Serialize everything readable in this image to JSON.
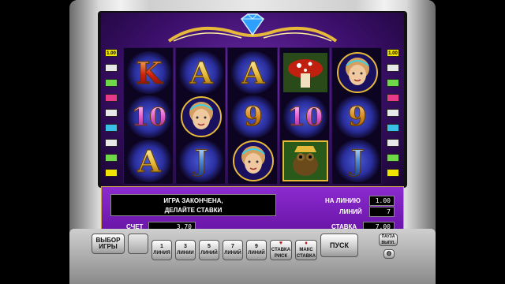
{
  "reels": [
    [
      "K",
      "10",
      "A"
    ],
    [
      "A",
      "woman-pic",
      "J"
    ],
    [
      "A",
      "9",
      "woman-face"
    ],
    [
      "mushroom",
      "10",
      "frog"
    ],
    [
      "woman-face",
      "9",
      "J"
    ]
  ],
  "line_indicators": {
    "left": [
      "1.00",
      "",
      "",
      "",
      "",
      "",
      "",
      "",
      ""
    ],
    "right": [
      "1.00",
      "",
      "",
      "",
      "",
      "",
      "",
      "",
      ""
    ]
  },
  "message": {
    "line1": "ИГРА ЗАКОНЧЕНА,",
    "line2": "ДЕЛАЙТЕ СТАВКИ"
  },
  "stats": {
    "per_line_label": "НА ЛИНИЮ",
    "per_line_value": "1.00",
    "lines_label": "ЛИНИЙ",
    "lines_value": "7",
    "score_label": "СЧЕТ",
    "score_value": "3.70",
    "bet_label": "СТАВКА",
    "bet_value": "7.00"
  },
  "buttons": {
    "select_game_1": "ВЫБОР",
    "select_game_2": "ИГРЫ",
    "hidden_label_1": "",
    "hidden_label_2": "",
    "lines_1_num": "1",
    "lines_1_txt": "ЛИНИЯ",
    "lines_3_num": "3",
    "lines_3_txt": "ЛИНИИ",
    "lines_5_num": "5",
    "lines_5_txt": "ЛИНИЙ",
    "lines_7_num": "7",
    "lines_7_txt": "ЛИНИЙ",
    "lines_9_num": "9",
    "lines_9_txt": "ЛИНИЙ",
    "bet_minus_1": "СТАВКА",
    "bet_minus_2": "РИСК",
    "max_bet_1": "МАКС",
    "max_bet_2": "СТАВКА",
    "start": "ПУСК",
    "autoplay_1": "ПАУЗА",
    "autoplay_2": "ВЫПЛ."
  },
  "colors": {
    "panel": "#7b1fbd",
    "screen": "#3b0f6a",
    "gold": "#e6b93a"
  }
}
